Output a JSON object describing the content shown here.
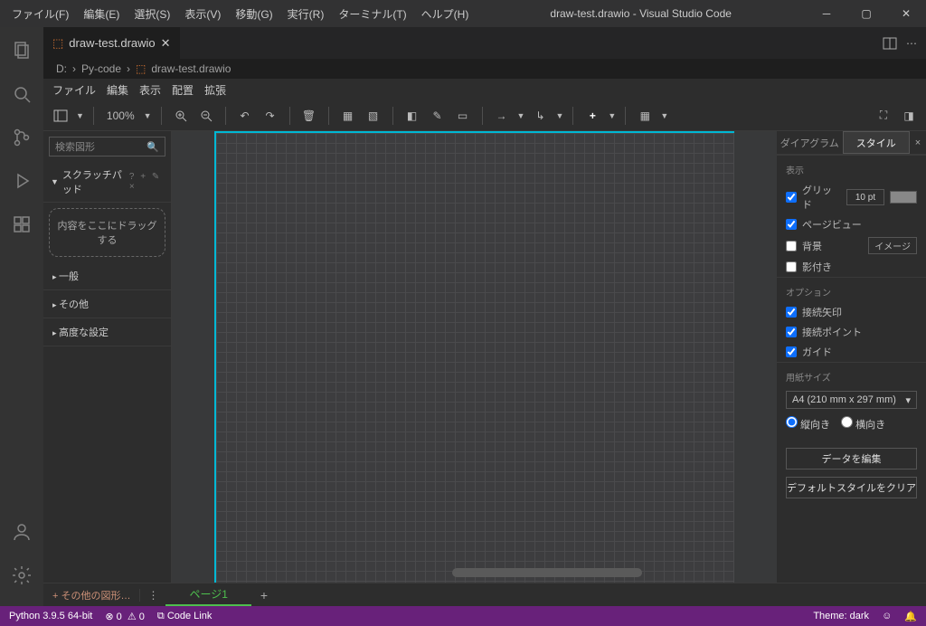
{
  "title": "draw-test.drawio - Visual Studio Code",
  "menubar": [
    "ファイル(F)",
    "編集(E)",
    "選択(S)",
    "表示(V)",
    "移動(G)",
    "実行(R)",
    "ターミナル(T)",
    "ヘルプ(H)"
  ],
  "tab": {
    "name": "draw-test.drawio"
  },
  "breadcrumb": {
    "root": "D:",
    "folder": "Py-code",
    "file": "draw-test.drawio"
  },
  "drawio_menu": [
    "ファイル",
    "編集",
    "表示",
    "配置",
    "拡張"
  ],
  "zoom": "100%",
  "left": {
    "search_placeholder": "検索図形",
    "scratchpad": "スクラッチパッド",
    "drop_hint": "内容をここにドラッグする",
    "cats": [
      "一般",
      "その他",
      "高度な設定"
    ]
  },
  "right": {
    "tab_diagram": "ダイアグラム",
    "tab_style": "スタイル",
    "sec_view": "表示",
    "grid": "グリッド",
    "grid_val": "10 pt",
    "pageview": "ページビュー",
    "background": "背景",
    "image_btn": "イメージ",
    "shadow": "影付き",
    "sec_options": "オプション",
    "conn_arrow": "接続矢印",
    "conn_point": "接続ポイント",
    "guide": "ガイド",
    "sec_paper": "用紙サイズ",
    "paper": "A4 (210 mm x 297 mm)",
    "portrait": "縦向き",
    "landscape": "横向き",
    "edit_data": "データを編集",
    "reset_style": "デフォルトスタイルをクリア"
  },
  "footer": {
    "more_shapes": "+ その他の図形…",
    "page": "ページ1"
  },
  "status": {
    "python": "Python 3.9.5 64-bit",
    "errors": "0",
    "warnings": "0",
    "codelink": "Code Link",
    "theme": "Theme: dark"
  }
}
